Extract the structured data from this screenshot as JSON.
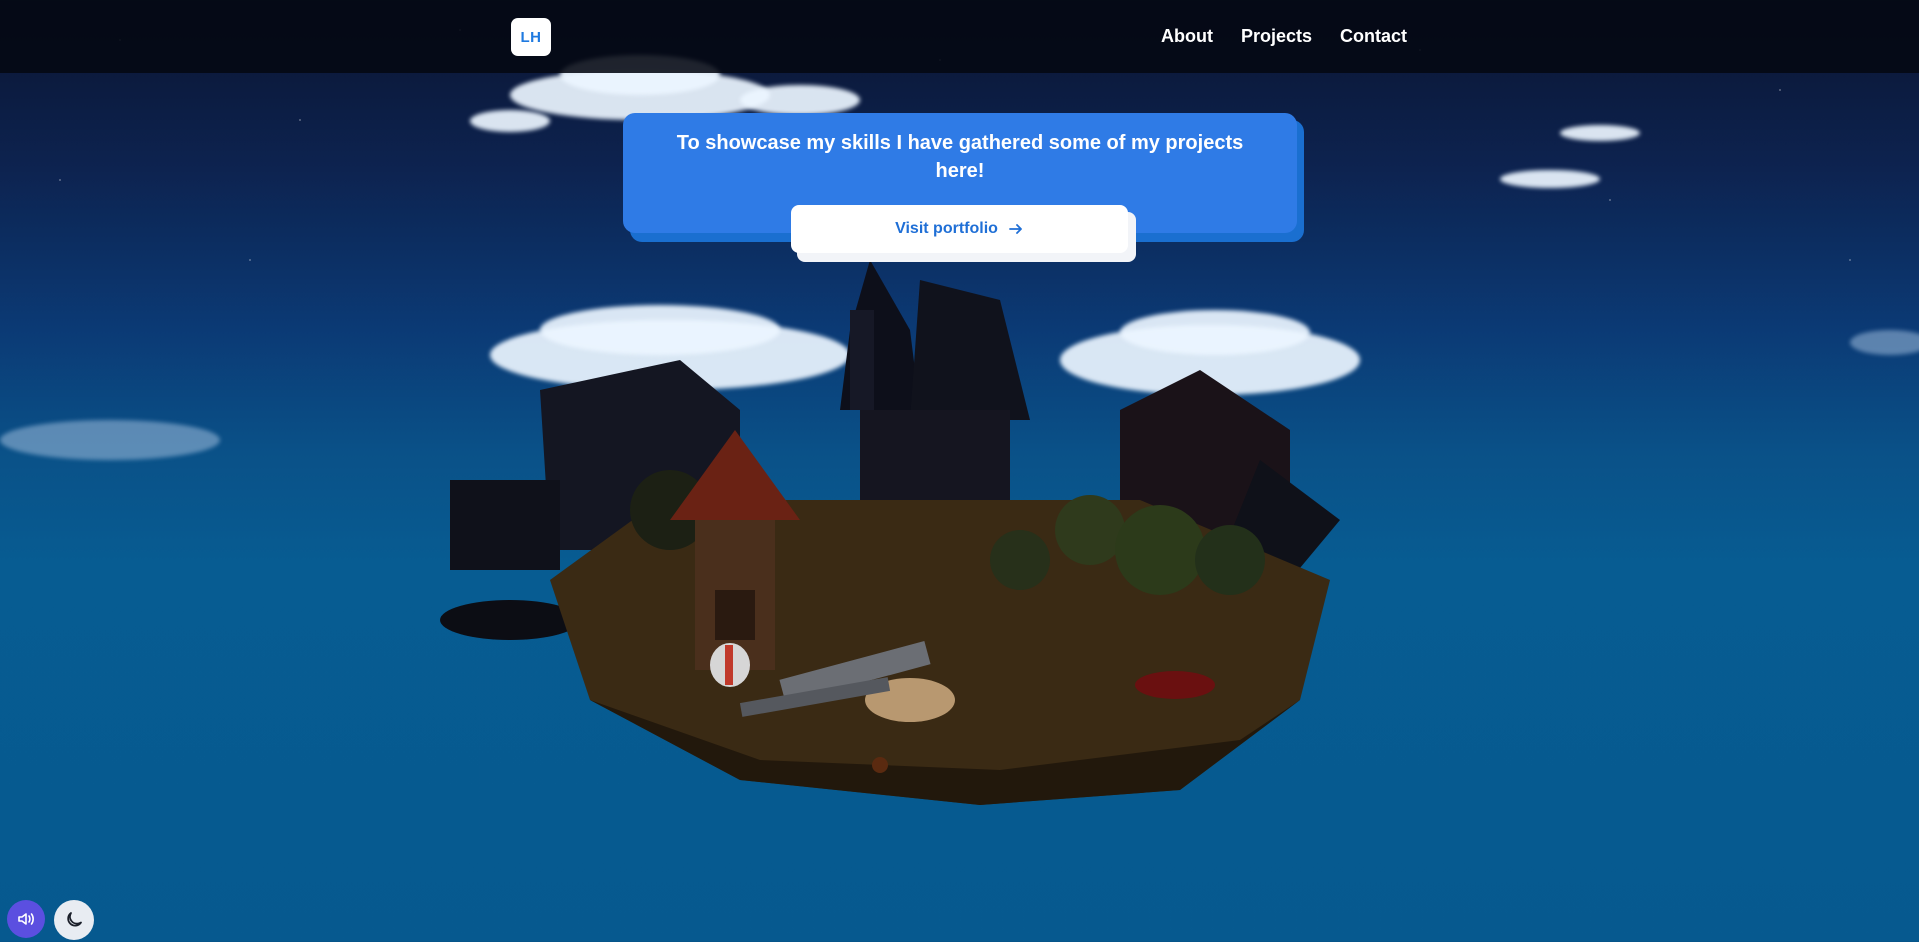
{
  "nav": {
    "logo_text": "LH",
    "links": [
      {
        "label": "About"
      },
      {
        "label": "Projects"
      },
      {
        "label": "Contact"
      }
    ]
  },
  "info_card": {
    "text": "To showcase my skills I have gathered some of my projects here!",
    "button_label": "Visit portfolio",
    "button_icon": "arrow-right-icon"
  },
  "controls": {
    "sound_icon": "speaker-icon",
    "theme_icon": "moon-icon"
  },
  "colors": {
    "card_bg": "#2f7be6",
    "button_text": "#1f6fd6",
    "sound_button_bg": "#5b4fe0",
    "nav_bg": "#05080f"
  }
}
